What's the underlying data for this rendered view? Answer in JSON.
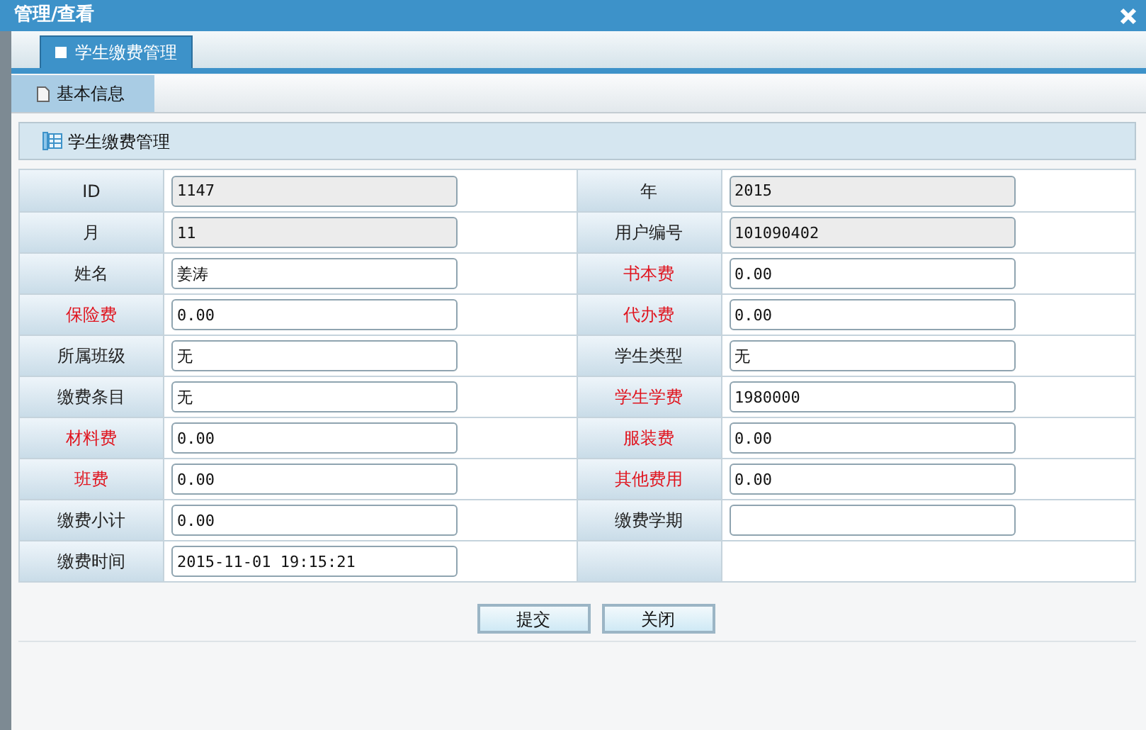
{
  "window": {
    "title": "管理/查看"
  },
  "tabs": [
    {
      "label": "学生缴费管理",
      "selected": true
    }
  ],
  "subtabs": [
    {
      "label": "基本信息",
      "selected": true
    }
  ],
  "section": {
    "title": "学生缴费管理"
  },
  "rows": [
    [
      {
        "label": "ID",
        "value": "1147",
        "required": false,
        "readonly": true
      },
      {
        "label": "年",
        "value": "2015",
        "required": false,
        "readonly": true
      }
    ],
    [
      {
        "label": "月",
        "value": "11",
        "required": false,
        "readonly": true
      },
      {
        "label": "用户编号",
        "value": "101090402",
        "required": false,
        "readonly": true
      }
    ],
    [
      {
        "label": "姓名",
        "value": "姜涛",
        "required": false,
        "readonly": false
      },
      {
        "label": "书本费",
        "value": "0.00",
        "required": true,
        "readonly": false
      }
    ],
    [
      {
        "label": "保险费",
        "value": "0.00",
        "required": true,
        "readonly": false
      },
      {
        "label": "代办费",
        "value": "0.00",
        "required": true,
        "readonly": false
      }
    ],
    [
      {
        "label": "所属班级",
        "value": "无",
        "required": false,
        "readonly": false
      },
      {
        "label": "学生类型",
        "value": "无",
        "required": false,
        "readonly": false
      }
    ],
    [
      {
        "label": "缴费条目",
        "value": "无",
        "required": false,
        "readonly": false
      },
      {
        "label": "学生学费",
        "value": "1980000",
        "required": true,
        "readonly": false
      }
    ],
    [
      {
        "label": "材料费",
        "value": "0.00",
        "required": true,
        "readonly": false
      },
      {
        "label": "服装费",
        "value": "0.00",
        "required": true,
        "readonly": false
      }
    ],
    [
      {
        "label": "班费",
        "value": "0.00",
        "required": true,
        "readonly": false
      },
      {
        "label": "其他费用",
        "value": "0.00",
        "required": true,
        "readonly": false
      }
    ],
    [
      {
        "label": "缴费小计",
        "value": "0.00",
        "required": false,
        "readonly": false
      },
      {
        "label": "缴费学期",
        "required": false,
        "readonly": false
      }
    ],
    [
      {
        "label": "缴费时间",
        "value": "2015-11-01 19:15:21",
        "required": false,
        "readonly": false
      }
    ]
  ],
  "buttons": [
    "提交",
    "关闭"
  ]
}
